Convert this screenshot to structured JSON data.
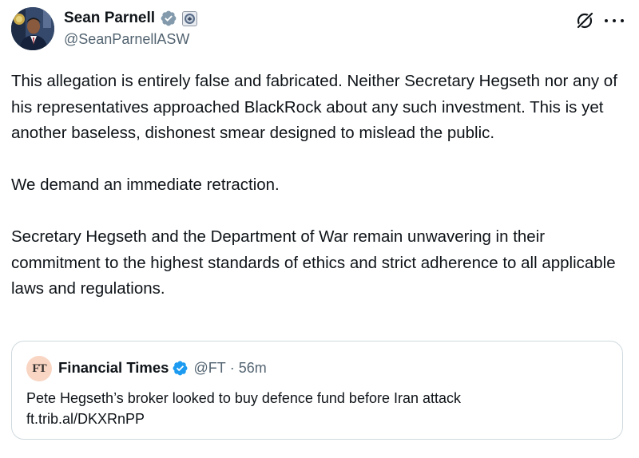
{
  "author": {
    "display_name": "Sean Parnell",
    "handle": "@SeanParnellASW",
    "verified_badge": "gray-verified-icon",
    "affiliation_badge": "government-seal-icon"
  },
  "actions": {
    "grok_icon": "grok-icon",
    "more_icon": "more-options-icon"
  },
  "post": {
    "paragraphs": [
      "This allegation is entirely false and fabricated. Neither Secretary Hegseth nor any of his representatives approached BlackRock about any such investment. This is yet another baseless, dishonest smear designed to mislead the public.",
      "We demand an immediate retraction.",
      "Secretary Hegseth and the Department of War remain unwavering in their commitment to the highest standards of ethics and strict adherence to all applicable laws and regulations."
    ]
  },
  "quote": {
    "avatar_text": "FT",
    "display_name": "Financial Times",
    "handle": "@FT",
    "separator": "·",
    "time": "56m",
    "text": "Pete Hegseth’s broker looked to buy defence fund before Iran attack",
    "link": "ft.trib.al/DKXRnPP"
  },
  "colors": {
    "text": "#0f1419",
    "secondary": "#536471",
    "verified_blue": "#1d9bf0",
    "verified_gray": "#829aab",
    "border": "#cfd9de"
  }
}
